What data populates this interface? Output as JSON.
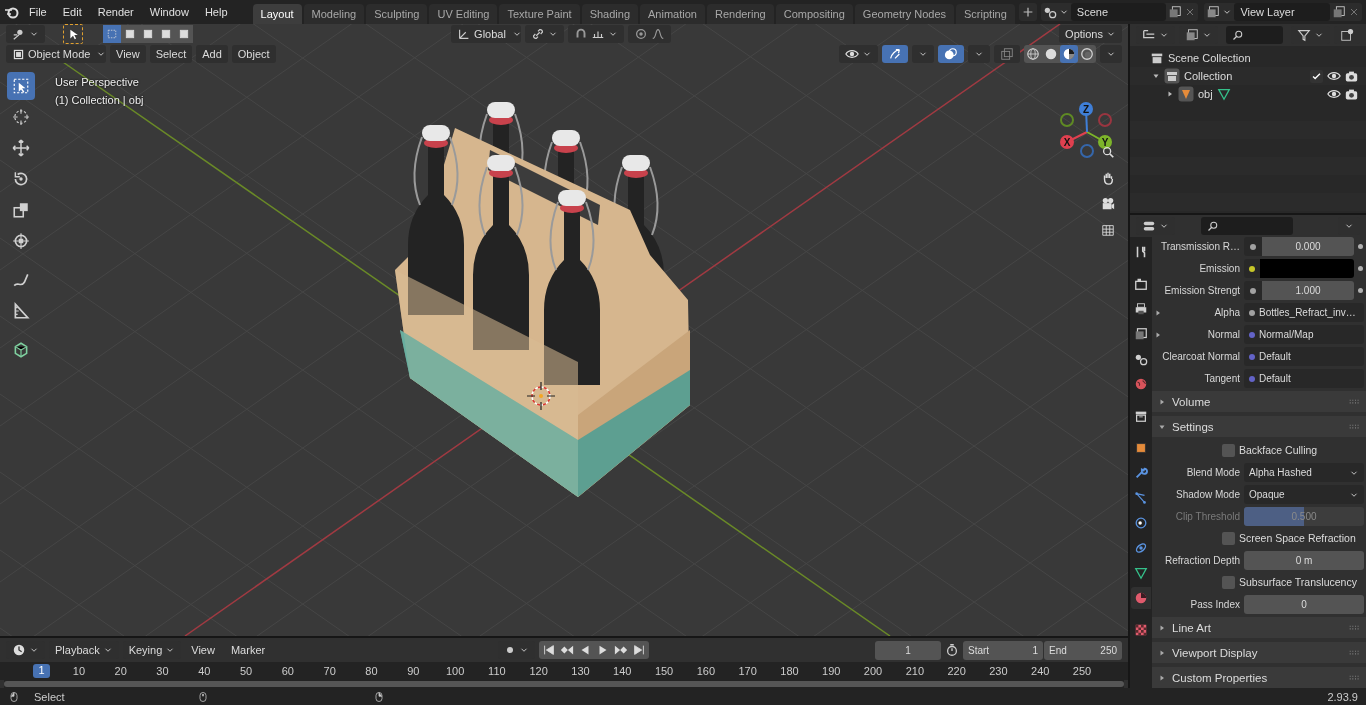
{
  "top_bar": {
    "menus": [
      "File",
      "Edit",
      "Render",
      "Window",
      "Help"
    ],
    "workspaces": [
      {
        "label": "Layout",
        "selected": true
      },
      {
        "label": "Modeling",
        "selected": false
      },
      {
        "label": "Sculpting",
        "selected": false
      },
      {
        "label": "UV Editing",
        "selected": false
      },
      {
        "label": "Texture Paint",
        "selected": false
      },
      {
        "label": "Shading",
        "selected": false
      },
      {
        "label": "Animation",
        "selected": false
      },
      {
        "label": "Rendering",
        "selected": false
      },
      {
        "label": "Compositing",
        "selected": false
      },
      {
        "label": "Geometry Nodes",
        "selected": false
      },
      {
        "label": "Scripting",
        "selected": false
      }
    ],
    "scene": "Scene",
    "view_layer": "View Layer"
  },
  "tool_header": {
    "select_modes": [
      {
        "selected": true
      },
      {
        "selected": false
      },
      {
        "selected": false
      },
      {
        "selected": false
      },
      {
        "selected": false
      }
    ],
    "orientation": "Global",
    "proportional_on": false,
    "options": "Options"
  },
  "viewport_header": {
    "mode": "Object Mode",
    "menus": [
      "View",
      "Select",
      "Add",
      "Object"
    ],
    "gizmos_on": true,
    "overlays_on": true,
    "shading": [
      {
        "kind": "wireframe",
        "selected": false
      },
      {
        "kind": "solid",
        "selected": false
      },
      {
        "kind": "material",
        "selected": true
      },
      {
        "kind": "rendered",
        "selected": false
      }
    ]
  },
  "toolbar": [
    {
      "kind": "select",
      "selected": true
    },
    {
      "kind": "cursor",
      "selected": false
    },
    {
      "kind": "move",
      "selected": false
    },
    {
      "kind": "rotate",
      "selected": false
    },
    {
      "kind": "scale",
      "selected": false
    },
    {
      "kind": "transform",
      "selected": false
    },
    {
      "kind": "annotate",
      "selected": false
    },
    {
      "kind": "measure",
      "selected": false
    },
    {
      "kind": "cube",
      "selected": false
    }
  ],
  "viewport": {
    "view_name": "User Perspective",
    "collection_info": "(1) Collection | obj",
    "gizmo_axes": [
      "X",
      "Y",
      "Z"
    ]
  },
  "outliner": {
    "items": [
      {
        "label": "Scene Collection",
        "kind": "scene",
        "children": [
          {
            "label": "Collection",
            "kind": "collection",
            "expanded": true,
            "checked": true,
            "children": [
              {
                "label": "obj",
                "kind": "object",
                "expanded": false
              }
            ]
          }
        ]
      }
    ]
  },
  "properties": {
    "tabs": [
      {
        "kind": "tool",
        "selected": false
      },
      {
        "kind": "render",
        "selected": false
      },
      {
        "kind": "output",
        "selected": false
      },
      {
        "kind": "viewlayer",
        "selected": false
      },
      {
        "kind": "scene",
        "selected": false
      },
      {
        "kind": "world",
        "selected": false
      },
      {
        "kind": "collection",
        "selected": false
      },
      {
        "kind": "object",
        "selected": false
      },
      {
        "kind": "modifier",
        "selected": false
      },
      {
        "kind": "particles",
        "selected": false
      },
      {
        "kind": "physics",
        "selected": false
      },
      {
        "kind": "constraints",
        "selected": false
      },
      {
        "kind": "data",
        "selected": false
      },
      {
        "kind": "material",
        "selected": true
      },
      {
        "kind": "texture",
        "selected": false
      }
    ],
    "rows": [
      {
        "kind": "number",
        "label": "Transmission R…",
        "value": "0.000",
        "color": "#a1a1a1"
      },
      {
        "kind": "swatch",
        "label": "Emission",
        "color": "#c7c729"
      },
      {
        "kind": "number",
        "label": "Emission Strengt",
        "value": "1.000",
        "color": "#a1a1a1"
      },
      {
        "kind": "link",
        "label": "Alpha",
        "value": "Bottles_Refract_inv…",
        "color": "#a1a1a1",
        "expanded": false
      },
      {
        "kind": "link",
        "label": "Normal",
        "value": "Normal/Map",
        "color": "#6363c7",
        "expanded": false
      },
      {
        "kind": "link",
        "label": "Clearcoat Normal",
        "value": "Default",
        "color": "#6363c7"
      },
      {
        "kind": "link",
        "label": "Tangent",
        "value": "Default",
        "color": "#6363c7"
      },
      {
        "kind": "panel",
        "label": "Volume",
        "expanded": false
      },
      {
        "kind": "panel",
        "label": "Settings",
        "expanded": true
      },
      {
        "kind": "checkbox",
        "label": "Backface Culling",
        "checked": false
      },
      {
        "kind": "dropdown",
        "label": "Blend Mode",
        "value": "Alpha Hashed"
      },
      {
        "kind": "dropdown",
        "label": "Shadow Mode",
        "value": "Opaque"
      },
      {
        "kind": "slider",
        "label": "Clip Threshold",
        "value": "0.500",
        "level": 0.5,
        "disabled": true
      },
      {
        "kind": "checkbox",
        "label": "Screen Space Refraction",
        "checked": false
      },
      {
        "kind": "field",
        "label": "Refraction Depth",
        "value": "0 m"
      },
      {
        "kind": "checkbox",
        "label": "Subsurface Translucency",
        "checked": false
      },
      {
        "kind": "field",
        "label": "Pass Index",
        "value": "0"
      },
      {
        "kind": "panel",
        "label": "Line Art",
        "expanded": false
      },
      {
        "kind": "panel",
        "label": "Viewport Display",
        "expanded": false
      },
      {
        "kind": "panel",
        "label": "Custom Properties",
        "expanded": false
      }
    ]
  },
  "timeline": {
    "playback": "Playback",
    "keying": "Keying",
    "menus": [
      "View",
      "Marker"
    ],
    "auto_keying_on": false,
    "current_frame": "1",
    "start_label": "Start",
    "start": "1",
    "end_label": "End",
    "end": "250",
    "marker": "1",
    "ticks": [
      "10",
      "20",
      "30",
      "40",
      "50",
      "60",
      "70",
      "80",
      "90",
      "100",
      "110",
      "120",
      "130",
      "140",
      "150",
      "160",
      "170",
      "180",
      "190",
      "200",
      "210",
      "220",
      "230",
      "240",
      "250"
    ]
  },
  "status_bar": {
    "hint": "Select",
    "version": "2.93.9"
  }
}
